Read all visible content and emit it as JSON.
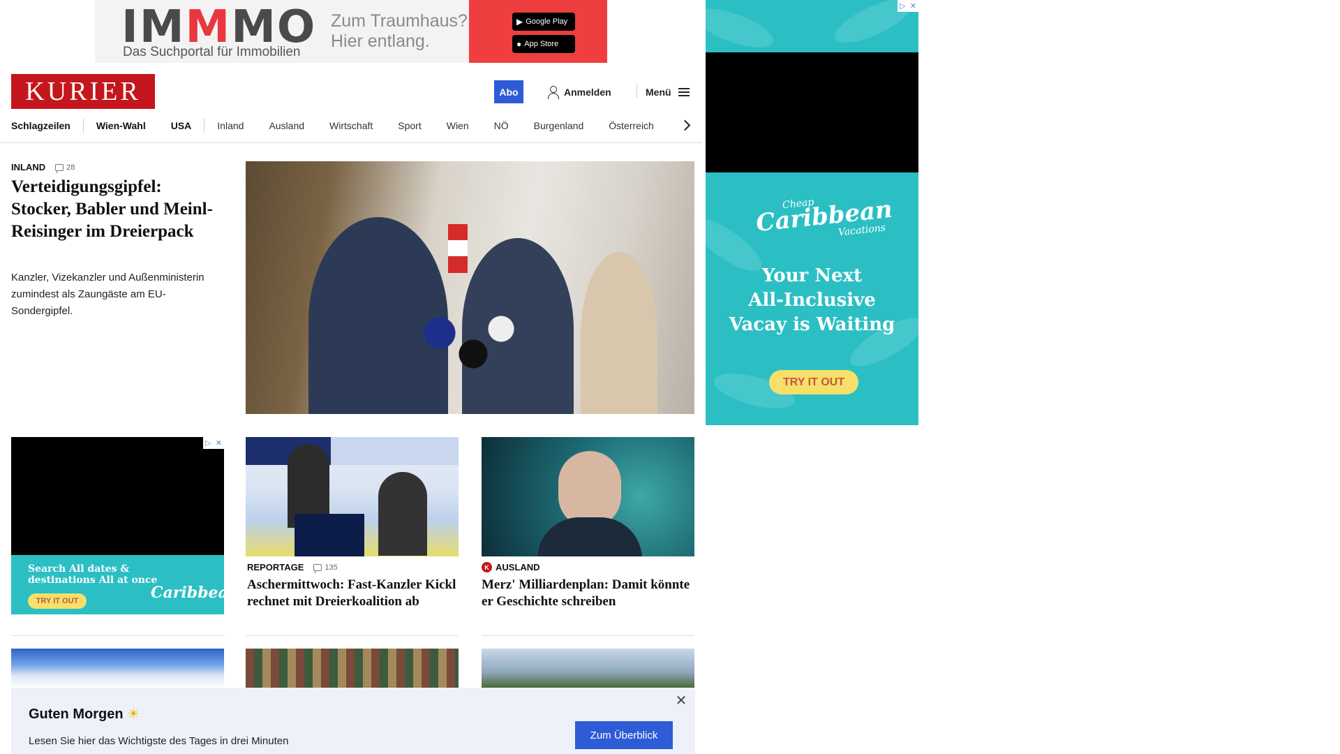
{
  "top_ad": {
    "brand_prefix": "IM",
    "brand_highlight": "M",
    "brand_suffix": "MO",
    "subtitle": "Das Suchportal für Immobilien",
    "slogan_line1": "Zum Traumhaus?",
    "slogan_line2": "Hier entlang.",
    "google_play_label": "Google Play",
    "app_store_label": "App Store"
  },
  "header": {
    "logo": "KURIER",
    "abo_label": "Abo",
    "login_label": "Anmelden",
    "menu_label": "Menü"
  },
  "nav": {
    "items": [
      "Schlagzeilen",
      "Wien-Wahl",
      "USA",
      "Inland",
      "Ausland",
      "Wirtschaft",
      "Sport",
      "Wien",
      "NÖ",
      "Burgenland",
      "Österreich"
    ]
  },
  "lead": {
    "category": "INLAND",
    "comments": "28",
    "title": "Verteidigungsgipfel: Stocker, Babler und Meinl-Reisinger im Dreierpack",
    "teaser": "Kanzler, Vizekanzler und Außenministerin zumindest als Zaungäste am EU-Sondergipfel."
  },
  "side_ad": {
    "logo_top": "Cheap",
    "logo_main": "Caribbean",
    "logo_bottom": "Vacations",
    "tagline_1": "Your Next",
    "tagline_2": "All-Inclusive",
    "tagline_3": "Vacay is Waiting",
    "cta": "TRY IT OUT"
  },
  "inline_ad": {
    "line1": "Search All dates &",
    "line2": "destinations All at once",
    "cta": "TRY IT OUT",
    "logo": "Caribbean"
  },
  "cards": [
    {
      "category": "REPORTAGE",
      "comments": "135",
      "title": "Aschermittwoch: Fast-Kanzler Kickl rechnet mit Dreierkoalition ab"
    },
    {
      "category": "AUSLAND",
      "badge": "K",
      "title": "Merz' Milliardenplan: Damit könnte er Geschichte schreiben"
    }
  ],
  "notification": {
    "greeting": "Guten Morgen",
    "sun": "☀",
    "subtitle": "Lesen Sie hier das Wichtigste des Tages in drei Minuten",
    "button": "Zum Überblick",
    "close": "✕"
  },
  "colors": {
    "brand_red": "#c4161c",
    "accent_blue": "#2e5bd6",
    "ad_teal": "#2bbfc4",
    "notify_bg": "#eef1f9"
  }
}
